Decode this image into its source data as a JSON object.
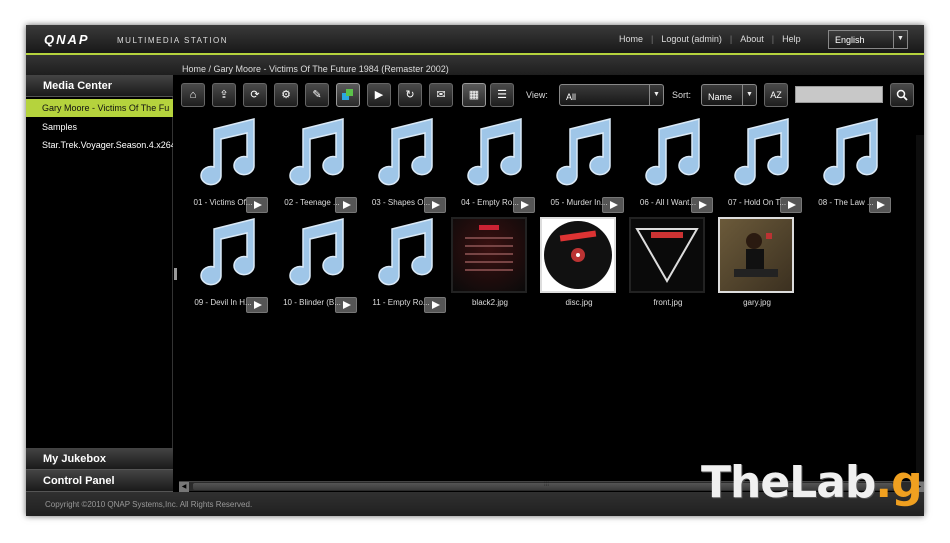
{
  "header": {
    "logo": "QNAP",
    "app_name": "MULTIMEDIA STATION",
    "nav": [
      "Home",
      "Logout (admin)",
      "About",
      "Help"
    ],
    "language": "English"
  },
  "breadcrumb": "Home / Gary Moore - Victims Of The Future 1984 (Remaster 2002)",
  "sidebar": {
    "media_center": "Media Center",
    "items": [
      {
        "label": "Gary Moore - Victims Of The Fu"
      },
      {
        "label": "Samples"
      },
      {
        "label": "Star.Trek.Voyager.Season.4.x264"
      }
    ],
    "my_jukebox": "My Jukebox",
    "control_panel": "Control Panel"
  },
  "toolbar": {
    "buttons": [
      "home-icon",
      "upload-icon",
      "refresh-icon",
      "settings-icon",
      "edit-icon",
      "copy-icon",
      "play-icon",
      "rotate-icon",
      "mail-icon",
      "grid-view-icon",
      "list-view-icon"
    ],
    "view_label": "View:",
    "view_value": "All",
    "sort_label": "Sort:",
    "sort_value": "Name",
    "sort_order_label": "AZ",
    "search_placeholder": ""
  },
  "files": [
    {
      "name": "01 - Victims Of...",
      "type": "audio"
    },
    {
      "name": "02 - Teenage ...",
      "type": "audio"
    },
    {
      "name": "03 - Shapes O...",
      "type": "audio"
    },
    {
      "name": "04 - Empty Ro...",
      "type": "audio"
    },
    {
      "name": "05 - Murder In...",
      "type": "audio"
    },
    {
      "name": "06 - All I Want...",
      "type": "audio"
    },
    {
      "name": "07 - Hold On T...",
      "type": "audio"
    },
    {
      "name": "08 - The Law ...",
      "type": "audio"
    },
    {
      "name": "09 - Devil In H...",
      "type": "audio"
    },
    {
      "name": "10 - Blinder (B...",
      "type": "audio"
    },
    {
      "name": "11 - Empty Ro...",
      "type": "audio"
    },
    {
      "name": "black2.jpg",
      "type": "image"
    },
    {
      "name": "disc.jpg",
      "type": "image"
    },
    {
      "name": "front.jpg",
      "type": "image"
    },
    {
      "name": "gary.jpg",
      "type": "image"
    }
  ],
  "footer": {
    "copyright": "Copyright ©2010 QNAP Systems,Inc. All Rights Reserved."
  },
  "watermark": {
    "part1": "TheLab",
    "part2": ".gr"
  },
  "colors": {
    "accent": "#b5d33d",
    "background": "#000000",
    "note_blue": "#9fc6e8"
  }
}
